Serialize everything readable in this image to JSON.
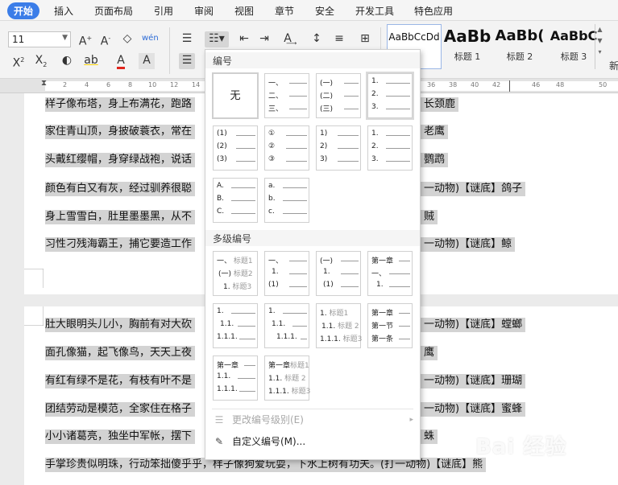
{
  "menu": {
    "tabs": [
      "开始",
      "插入",
      "页面布局",
      "引用",
      "审阅",
      "视图",
      "章节",
      "安全",
      "开发工具",
      "特色应用"
    ]
  },
  "ribbon": {
    "font_size": "11",
    "styles": [
      {
        "preview": "AaBbCcDd",
        "name": ""
      },
      {
        "preview": "AaBb",
        "name": "标题 1"
      },
      {
        "preview": "AaBb(",
        "name": "标题 2"
      },
      {
        "preview": "AaBbC",
        "name": "标题 3"
      }
    ],
    "new_label": "新"
  },
  "ruler": {
    "ticks": [
      "2",
      "4",
      "6",
      "8",
      "10",
      "12",
      "14",
      "16",
      "18",
      "20",
      "22",
      "24",
      "26",
      "28",
      "30",
      "32",
      "34",
      "36",
      "38",
      "40",
      "42",
      "44",
      "46",
      "48",
      "50"
    ]
  },
  "document": {
    "page1_lines": [
      {
        "text": "样子像布塔，身上布满花，跑路",
        "suffix": "长颈鹿"
      },
      {
        "text": "家住青山顶，身披破蓑衣，常在",
        "suffix": "老鹰"
      },
      {
        "text": "头戴红缨帽，身穿绿战袍，说话",
        "suffix": "鹦鹉"
      },
      {
        "text": "颜色有白又有灰，经过驯养很聪",
        "suffix": "一动物)【谜底】鸽子"
      },
      {
        "text": "身上雪雪白，肚里墨墨黑，从不",
        "suffix": "贼"
      },
      {
        "text": "习性刁残海霸王，捕它要造工作",
        "suffix": "一动物)【谜底】鲸"
      }
    ],
    "page2_lines": [
      {
        "text": "肚大眼明头儿小，胸前有对大砍",
        "suffix": "一动物)【谜底】螳螂"
      },
      {
        "text": "面孔像猫，起飞像鸟，天天上夜",
        "suffix": "鹰"
      },
      {
        "text": "有红有绿不是花，有枝有叶不是",
        "suffix": "一动物)【谜底】珊瑚"
      },
      {
        "text": "团结劳动是模范，全家住在格子",
        "suffix": "一动物)【谜底】蜜蜂"
      },
      {
        "text": "小小诸葛亮，独坐中军帐，摆下",
        "suffix": "蛛"
      },
      {
        "text": "手掌珍贵似明珠，行动笨拙傻乎乎，样子像狗爱玩耍，下水上树有功夫。(打一动物)【谜底】熊",
        "suffix": ""
      }
    ]
  },
  "numbering_dropdown": {
    "section_numbering": "编号",
    "none_label": "无",
    "single_presets": [
      [
        "一、",
        "二、",
        "三、"
      ],
      [
        "(一)",
        "(二)",
        "(三)"
      ],
      [
        "1.",
        "2.",
        "3."
      ],
      [
        "(1)",
        "(2)",
        "(3)"
      ],
      [
        "①",
        "②",
        "③"
      ],
      [
        "1)",
        "2)",
        "3)"
      ],
      [
        "1.",
        "2.",
        "3."
      ],
      [
        "A.",
        "B.",
        "C."
      ],
      [
        "a.",
        "b.",
        "c."
      ]
    ],
    "section_multilevel": "多级编号",
    "multilevel_presets": [
      [
        {
          "n": "一、",
          "t": "标题1"
        },
        {
          "n": "(一)",
          "t": "标题2"
        },
        {
          "n": "1.",
          "t": "标题3"
        }
      ],
      [
        {
          "n": "一、",
          "t": ""
        },
        {
          "n": "1.",
          "t": ""
        },
        {
          "n": "(1)",
          "t": ""
        }
      ],
      [
        {
          "n": "(一)",
          "t": ""
        },
        {
          "n": "1.",
          "t": ""
        },
        {
          "n": "(1)",
          "t": ""
        }
      ],
      [
        {
          "n": "第一章",
          "t": ""
        },
        {
          "n": "一、",
          "t": ""
        },
        {
          "n": "1.",
          "t": ""
        }
      ],
      [
        {
          "n": "1.",
          "t": ""
        },
        {
          "n": "1.1.",
          "t": ""
        },
        {
          "n": "1.1.1.",
          "t": ""
        }
      ],
      [
        {
          "n": "1.",
          "t": ""
        },
        {
          "n": "1.1.",
          "t": ""
        },
        {
          "n": "1.1.1.",
          "t": ""
        }
      ],
      [
        {
          "n": "1.",
          "t": "标题1"
        },
        {
          "n": "1.1.",
          "t": "标题 2"
        },
        {
          "n": "1.1.1.",
          "t": "标题3"
        }
      ],
      [
        {
          "n": "第一章",
          "t": ""
        },
        {
          "n": "第一节",
          "t": ""
        },
        {
          "n": "第一条",
          "t": ""
        }
      ],
      [
        {
          "n": "第一章",
          "t": ""
        },
        {
          "n": "1.1.",
          "t": ""
        },
        {
          "n": "1.1.1.",
          "t": ""
        }
      ],
      [
        {
          "n": "第一章",
          "t": "标题1"
        },
        {
          "n": "1.1.",
          "t": "标题 2"
        },
        {
          "n": "1.1.1.",
          "t": "标题3"
        }
      ]
    ],
    "change_level_label": "更改编号级别(E)",
    "custom_label": "自定义编号(M)..."
  },
  "watermark": "Bai 经验"
}
